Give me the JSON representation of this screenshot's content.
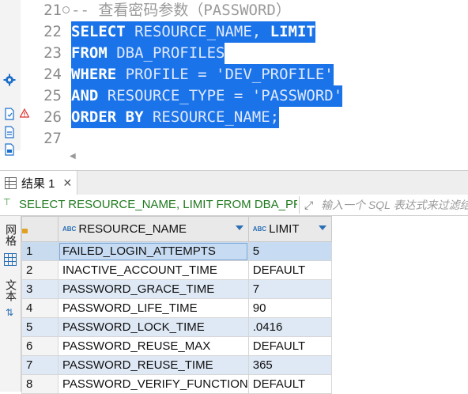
{
  "editor": {
    "lines": [
      {
        "number": "21",
        "parts": [
          {
            "t": "-- 查看密码参数（PASSWORD）",
            "c": "comment"
          }
        ],
        "selected": false,
        "fold": true
      },
      {
        "number": "22",
        "parts": [
          {
            "t": "SELECT",
            "c": "kw"
          },
          {
            "t": " RESOURCE_NAME, ",
            "c": "id"
          },
          {
            "t": "LIMIT",
            "c": "kw"
          }
        ],
        "selected": true
      },
      {
        "number": "23",
        "parts": [
          {
            "t": "FROM",
            "c": "kw"
          },
          {
            "t": " DBA_PROFILES",
            "c": "id"
          }
        ],
        "selected": true
      },
      {
        "number": "24",
        "parts": [
          {
            "t": "WHERE",
            "c": "kw"
          },
          {
            "t": " PROFILE = 'DEV_PROFILE'",
            "c": "id"
          }
        ],
        "selected": true
      },
      {
        "number": "25",
        "parts": [
          {
            "t": "AND",
            "c": "kw"
          },
          {
            "t": " RESOURCE_TYPE = 'PASSWORD'",
            "c": "id"
          }
        ],
        "selected": true
      },
      {
        "number": "26",
        "parts": [
          {
            "t": "ORDER BY",
            "c": "kw"
          },
          {
            "t": " RESOURCE_NAME;",
            "c": "id"
          }
        ],
        "selected": true
      },
      {
        "number": "27",
        "parts": [],
        "selected": false
      }
    ]
  },
  "results": {
    "tab_label": "结果 1",
    "tab_close": "✕",
    "filter_prefix": "⊤",
    "query_text": "SELECT RESOURCE_NAME, LIMIT FROM DBA_PROFILES WHERE PROFILE = 'DEV_PROFILE' AND RESOURCE_TYPE = 'PASSWORD' ORDER BY RESOURCE_NAME",
    "filter_placeholder": "输入一个 SQL 表达式来过滤结果",
    "side_tab_grid": "网格",
    "side_tab_text": "文本",
    "columns": [
      {
        "type_badge": "ABC",
        "label": "RESOURCE_NAME"
      },
      {
        "type_badge": "ABC",
        "label": "LIMIT"
      }
    ],
    "rows": [
      {
        "n": "1",
        "resource_name": "FAILED_LOGIN_ATTEMPTS",
        "limit": "5"
      },
      {
        "n": "2",
        "resource_name": "INACTIVE_ACCOUNT_TIME",
        "limit": "DEFAULT"
      },
      {
        "n": "3",
        "resource_name": "PASSWORD_GRACE_TIME",
        "limit": "7"
      },
      {
        "n": "4",
        "resource_name": "PASSWORD_LIFE_TIME",
        "limit": "90"
      },
      {
        "n": "5",
        "resource_name": "PASSWORD_LOCK_TIME",
        "limit": ".0416"
      },
      {
        "n": "6",
        "resource_name": "PASSWORD_REUSE_MAX",
        "limit": "DEFAULT"
      },
      {
        "n": "7",
        "resource_name": "PASSWORD_REUSE_TIME",
        "limit": "365"
      },
      {
        "n": "8",
        "resource_name": "PASSWORD_VERIFY_FUNCTION",
        "limit": "DEFAULT"
      }
    ],
    "selected_row": 0
  },
  "colors": {
    "selection": "#1a73e8",
    "header_active": "#8fc3ea",
    "row_alt": "#dfe9f5",
    "query_text": "#1f7a1f"
  },
  "icons": [
    "settings-gear-icon",
    "script-file-icon",
    "warning-icon",
    "sql-file-icon",
    "grid-icon",
    "expand-icon",
    "sort-arrow-icon",
    "lock-icon"
  ]
}
